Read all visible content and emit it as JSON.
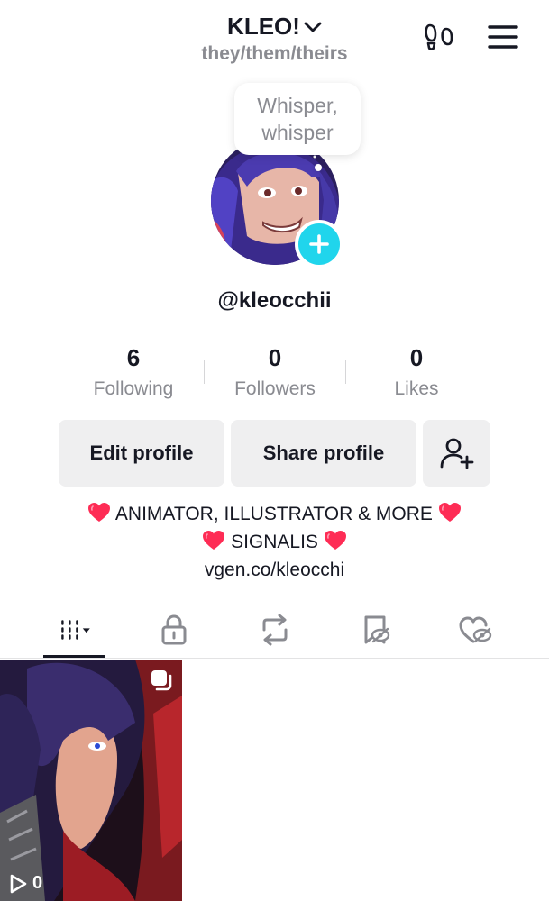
{
  "header": {
    "display_name": "KLEO!",
    "pronouns": "they/them/theirs"
  },
  "status_bubble": {
    "text_line1": "Whisper,",
    "text_line2": "whisper"
  },
  "profile": {
    "username": "@kleocchii"
  },
  "stats": [
    {
      "value": "6",
      "label": "Following"
    },
    {
      "value": "0",
      "label": "Followers"
    },
    {
      "value": "0",
      "label": "Likes"
    }
  ],
  "actions": {
    "edit_label": "Edit profile",
    "share_label": "Share profile"
  },
  "bio": {
    "line1": "ANIMATOR, ILLUSTRATOR & MORE",
    "line2": "SIGNALIS",
    "link": "vgen.co/kleocchi"
  },
  "tabs": [
    "videos-grid-icon",
    "lock-icon",
    "repost-icon",
    "favorites-icon",
    "liked-icon"
  ],
  "videos": [
    {
      "views": "0"
    }
  ],
  "colors": {
    "accent": "#20d5ec",
    "heart": "#fe2c55",
    "text": "#161823",
    "muted": "#8a8b91",
    "button_bg": "#efeff0"
  }
}
